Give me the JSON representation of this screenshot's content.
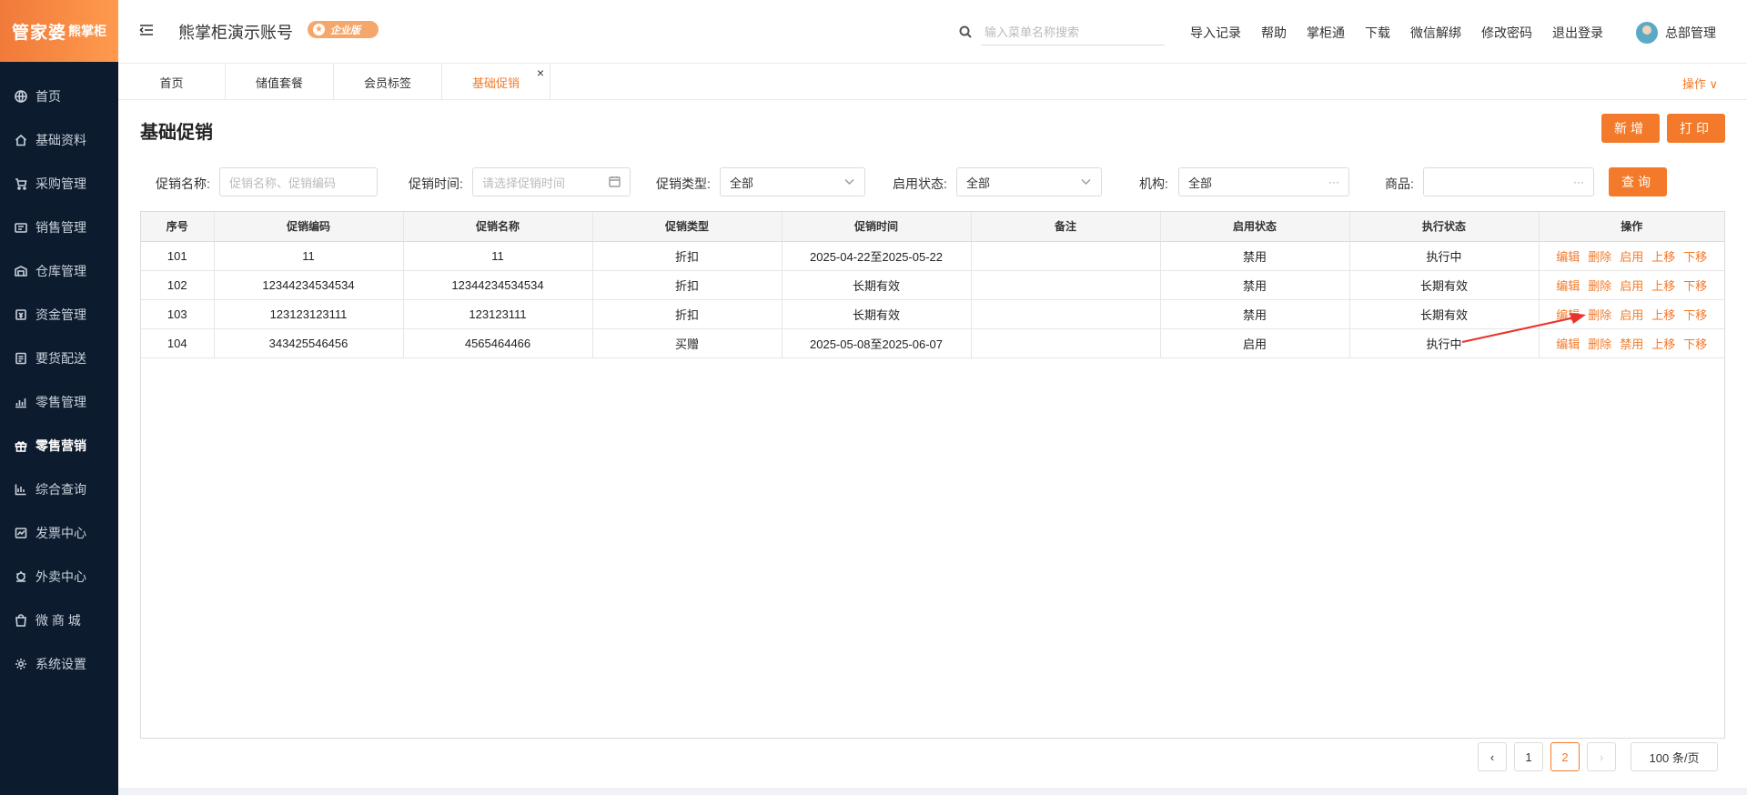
{
  "brand": {
    "logo_main": "管家婆",
    "logo_sub": "熊掌柜"
  },
  "sidebar": {
    "items": [
      {
        "label": "首页",
        "icon": "globe-icon",
        "active": false
      },
      {
        "label": "基础资料",
        "icon": "home-icon",
        "active": false
      },
      {
        "label": "采购管理",
        "icon": "cart-icon",
        "active": false
      },
      {
        "label": "销售管理",
        "icon": "sales-icon",
        "active": false
      },
      {
        "label": "仓库管理",
        "icon": "warehouse-icon",
        "active": false
      },
      {
        "label": "资金管理",
        "icon": "money-icon",
        "active": false
      },
      {
        "label": "要货配送",
        "icon": "delivery-icon",
        "active": false
      },
      {
        "label": "零售管理",
        "icon": "retail-icon",
        "active": false
      },
      {
        "label": "零售营销",
        "icon": "gift-icon",
        "active": true
      },
      {
        "label": "综合查询",
        "icon": "chart-icon",
        "active": false
      },
      {
        "label": "发票中心",
        "icon": "invoice-icon",
        "active": false
      },
      {
        "label": "外卖中心",
        "icon": "takeout-icon",
        "active": false
      },
      {
        "label": "微 商 城",
        "icon": "shop-icon",
        "active": false
      },
      {
        "label": "系统设置",
        "icon": "gear-icon",
        "active": false
      }
    ]
  },
  "header": {
    "account_name": "熊掌柜演示账号",
    "edition_badge": "企业版",
    "search_placeholder": "输入菜单名称搜索",
    "links": [
      "导入记录",
      "帮助",
      "掌柜通",
      "下载",
      "微信解绑",
      "修改密码",
      "退出登录"
    ],
    "user_name": "总部管理"
  },
  "tabs": {
    "items": [
      {
        "label": "首页",
        "active": false
      },
      {
        "label": "储值套餐",
        "active": false
      },
      {
        "label": "会员标签",
        "active": false
      },
      {
        "label": "基础促销",
        "active": true
      }
    ],
    "close_symbol": "×",
    "ops_label": "操作 ∨"
  },
  "page": {
    "title": "基础促销",
    "btn_new": "新增",
    "btn_print": "打印",
    "btn_query": "查询"
  },
  "filters": {
    "name_label": "促销名称:",
    "name_placeholder": "促销名称、促销编码",
    "time_label": "促销时间:",
    "time_placeholder": "请选择促销时间",
    "type_label": "促销类型:",
    "type_value": "全部",
    "status_label": "启用状态:",
    "status_value": "全部",
    "org_label": "机构:",
    "org_value": "全部",
    "goods_label": "商品:",
    "goods_value": "",
    "more_symbol": "···"
  },
  "table": {
    "columns": [
      "序号",
      "促销编码",
      "促销名称",
      "促销类型",
      "促销时间",
      "备注",
      "启用状态",
      "执行状态",
      "操作"
    ],
    "rows": [
      {
        "seq": "101",
        "code": "11",
        "name": "11",
        "type": "折扣",
        "time": "2025-04-22至2025-05-22",
        "remark": "",
        "enabled": "禁用",
        "exec": "执行中",
        "ops": [
          "编辑",
          "删除",
          "启用",
          "上移",
          "下移"
        ]
      },
      {
        "seq": "102",
        "code": "12344234534534",
        "name": "12344234534534",
        "type": "折扣",
        "time": "长期有效",
        "remark": "",
        "enabled": "禁用",
        "exec": "长期有效",
        "ops": [
          "编辑",
          "删除",
          "启用",
          "上移",
          "下移"
        ]
      },
      {
        "seq": "103",
        "code": "123123123111",
        "name": "123123111",
        "type": "折扣",
        "time": "长期有效",
        "remark": "",
        "enabled": "禁用",
        "exec": "长期有效",
        "ops": [
          "编辑",
          "删除",
          "启用",
          "上移",
          "下移"
        ]
      },
      {
        "seq": "104",
        "code": "343425546456",
        "name": "4565464466",
        "type": "买赠",
        "time": "2025-05-08至2025-06-07",
        "remark": "",
        "enabled": "启用",
        "exec": "执行中",
        "ops": [
          "编辑",
          "删除",
          "禁用",
          "上移",
          "下移"
        ]
      }
    ]
  },
  "pagination": {
    "prev": "‹",
    "pages": [
      "1",
      "2"
    ],
    "current": "2",
    "next": "›",
    "page_size": "100 条/页"
  },
  "colors": {
    "accent": "#f27a2a",
    "sidebar_bg": "#0c1b2e",
    "arrow": "#e8332a"
  }
}
